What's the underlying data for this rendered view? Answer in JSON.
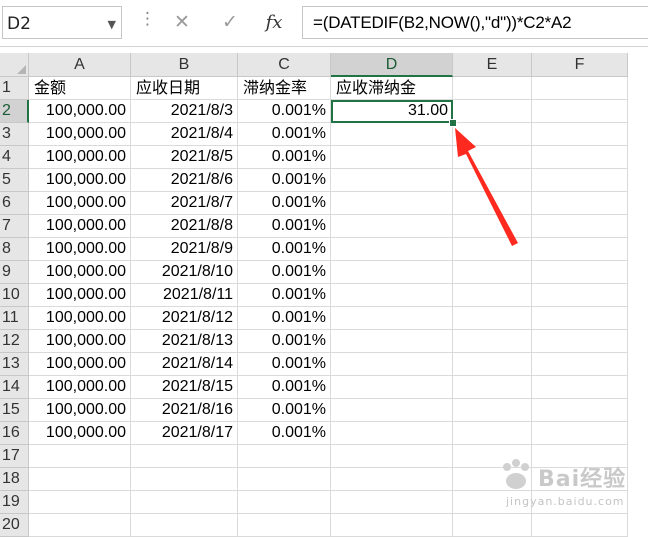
{
  "namebox": {
    "value": "D2"
  },
  "formula_bar": {
    "dots": "⋮",
    "cancel_icon": "✕",
    "enter_icon": "✓",
    "fx_label": "fx",
    "formula": "=(DATEDIF(B2,NOW(),\"d\"))*C2*A2"
  },
  "columns": [
    "A",
    "B",
    "C",
    "D",
    "E",
    "F"
  ],
  "selected_column": "D",
  "selected_row": "2",
  "rows": [
    {
      "num": "1",
      "a": "金额",
      "b": "应收日期",
      "c": "滞纳金率",
      "d": "应收滞纳金"
    },
    {
      "num": "2",
      "a": "100,000.00",
      "b": "2021/8/3",
      "c": "0.001%",
      "d": "31.00"
    },
    {
      "num": "3",
      "a": "100,000.00",
      "b": "2021/8/4",
      "c": "0.001%",
      "d": ""
    },
    {
      "num": "4",
      "a": "100,000.00",
      "b": "2021/8/5",
      "c": "0.001%",
      "d": ""
    },
    {
      "num": "5",
      "a": "100,000.00",
      "b": "2021/8/6",
      "c": "0.001%",
      "d": ""
    },
    {
      "num": "6",
      "a": "100,000.00",
      "b": "2021/8/7",
      "c": "0.001%",
      "d": ""
    },
    {
      "num": "7",
      "a": "100,000.00",
      "b": "2021/8/8",
      "c": "0.001%",
      "d": ""
    },
    {
      "num": "8",
      "a": "100,000.00",
      "b": "2021/8/9",
      "c": "0.001%",
      "d": ""
    },
    {
      "num": "9",
      "a": "100,000.00",
      "b": "2021/8/10",
      "c": "0.001%",
      "d": ""
    },
    {
      "num": "10",
      "a": "100,000.00",
      "b": "2021/8/11",
      "c": "0.001%",
      "d": ""
    },
    {
      "num": "11",
      "a": "100,000.00",
      "b": "2021/8/12",
      "c": "0.001%",
      "d": ""
    },
    {
      "num": "12",
      "a": "100,000.00",
      "b": "2021/8/13",
      "c": "0.001%",
      "d": ""
    },
    {
      "num": "13",
      "a": "100,000.00",
      "b": "2021/8/14",
      "c": "0.001%",
      "d": ""
    },
    {
      "num": "14",
      "a": "100,000.00",
      "b": "2021/8/15",
      "c": "0.001%",
      "d": ""
    },
    {
      "num": "15",
      "a": "100,000.00",
      "b": "2021/8/16",
      "c": "0.001%",
      "d": ""
    },
    {
      "num": "16",
      "a": "100,000.00",
      "b": "2021/8/17",
      "c": "0.001%",
      "d": ""
    },
    {
      "num": "17",
      "a": "",
      "b": "",
      "c": "",
      "d": ""
    },
    {
      "num": "18",
      "a": "",
      "b": "",
      "c": "",
      "d": ""
    },
    {
      "num": "19",
      "a": "",
      "b": "",
      "c": "",
      "d": ""
    },
    {
      "num": "20",
      "a": "",
      "b": "",
      "c": "",
      "d": ""
    }
  ],
  "colors": {
    "selection": "#217346",
    "arrow": "#ff2a1f",
    "header_bg": "#e6e6e6"
  },
  "icons": {
    "cancel": "close-icon",
    "enter": "check-icon",
    "fx": "function-icon",
    "arrow": "red-arrow-annotation"
  },
  "watermark": {
    "text": "Bai经验",
    "url": "jingyan.baidu.com"
  }
}
